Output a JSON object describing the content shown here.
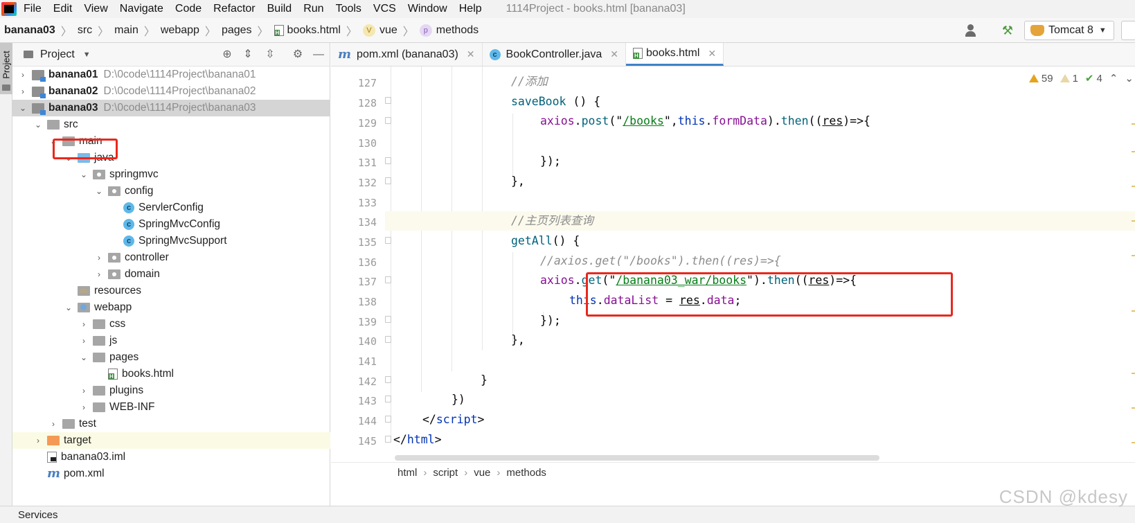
{
  "menubar": {
    "items": [
      "File",
      "Edit",
      "View",
      "Navigate",
      "Code",
      "Refactor",
      "Build",
      "Run",
      "Tools",
      "VCS",
      "Window",
      "Help"
    ],
    "window_title": "1114Project - books.html [banana03]"
  },
  "navbar": {
    "crumbs": [
      "banana03",
      "src",
      "main",
      "webapp",
      "pages",
      "books.html",
      "vue",
      "methods"
    ],
    "run_config": "Tomcat 8"
  },
  "left_stripe": {
    "label": "Project"
  },
  "project": {
    "title": "Project",
    "tree": [
      {
        "name": "banana01",
        "path": "D:\\0code\\1114Project\\banana01"
      },
      {
        "name": "banana02",
        "path": "D:\\0code\\1114Project\\banana02"
      },
      {
        "name": "banana03",
        "path": "D:\\0code\\1114Project\\banana03"
      },
      {
        "name": "src"
      },
      {
        "name": "main"
      },
      {
        "name": "java"
      },
      {
        "name": "springmvc"
      },
      {
        "name": "config"
      },
      {
        "name": "ServlerConfig"
      },
      {
        "name": "SpringMvcConfig"
      },
      {
        "name": "SpringMvcSupport"
      },
      {
        "name": "controller"
      },
      {
        "name": "domain"
      },
      {
        "name": "resources"
      },
      {
        "name": "webapp"
      },
      {
        "name": "css"
      },
      {
        "name": "js"
      },
      {
        "name": "pages"
      },
      {
        "name": "books.html"
      },
      {
        "name": "plugins"
      },
      {
        "name": "WEB-INF"
      },
      {
        "name": "test"
      },
      {
        "name": "target"
      },
      {
        "name": "banana03.iml"
      },
      {
        "name": "pom.xml"
      }
    ]
  },
  "editor": {
    "tabs": [
      "pom.xml (banana03)",
      "BookController.java",
      "books.html"
    ],
    "inspections": {
      "warnings": "59",
      "weak_warnings": "1",
      "typos": "4"
    },
    "line_numbers": [
      "127",
      "128",
      "129",
      "130",
      "131",
      "132",
      "133",
      "134",
      "135",
      "136",
      "137",
      "138",
      "139",
      "140",
      "141",
      "142",
      "143",
      "144",
      "145"
    ],
    "code": {
      "l127_comment": "//添加",
      "l128_name": "saveBook",
      "l128_rest": " () {",
      "l129_obj": "axios",
      "l129_dot": ".",
      "l129_fn": "post",
      "l129_open": "(\"",
      "l129_str": "/books",
      "l129_close": "\",",
      "l129_this": "this",
      "l129_dot2": ".",
      "l129_field": "formData",
      "l129_then_pre": ").",
      "l129_then": "then",
      "l129_paren": "((",
      "l129_param": "res",
      "l129_arrow": ")=>{",
      "l131": "});",
      "l132": "},",
      "l134_comment": "//主页列表查询",
      "l135_name": "getAll",
      "l135_rest": "() {",
      "l136_comment": "//axios.get(\"/books\").then((res)=>{",
      "l137_obj": "axios",
      "l137_dot": ".",
      "l137_fn": "get",
      "l137_open": "(\"",
      "l137_str": "/banana03_war/books",
      "l137_then_pre": "\").",
      "l137_then": "then",
      "l137_paren": "((",
      "l137_param": "res",
      "l137_arrow": ")=>{",
      "l138_this": "this",
      "l138_dot": ".",
      "l138_field": "dataList",
      "l138_eq": " = ",
      "l138_param": "res",
      "l138_dot2": ".",
      "l138_field2": "data",
      "l138_semi": ";",
      "l139": "});",
      "l140": "},",
      "l142": "}",
      "l143": "})",
      "l144_open": "</",
      "l144_tag": "script",
      "l144_close": ">",
      "l145_open": "</",
      "l145_tag": "html",
      "l145_close": ">"
    }
  },
  "editor_breadcrumb": [
    "html",
    "script",
    "vue",
    "methods"
  ],
  "statusbar": {
    "services": "Services"
  },
  "watermark": "CSDN @kdesy",
  "colors": {
    "highlight_box": "#e8281e",
    "comment": "#8c8c8c",
    "string": "#067d17",
    "keyword": "#0033b3",
    "field": "#871094",
    "method": "#00627a"
  }
}
